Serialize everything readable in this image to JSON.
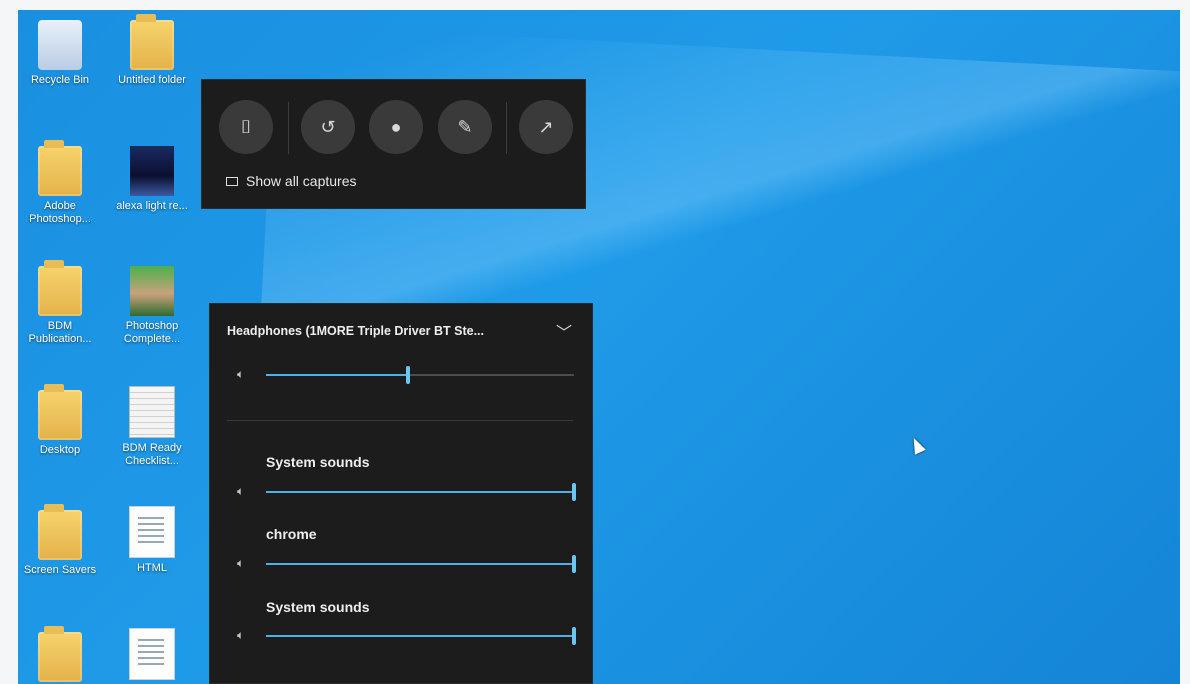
{
  "desktop_icons": [
    {
      "label": "Recycle Bin",
      "icon": "recycle-bin-icon"
    },
    {
      "label": "Untitled folder",
      "icon": "folder-icon"
    },
    {
      "label": "Adobe Photoshop...",
      "icon": "folder-icon"
    },
    {
      "label": "alexa light re...",
      "icon": "image-icon"
    },
    {
      "label": "BDM Publication...",
      "icon": "folder-icon"
    },
    {
      "label": "Photoshop Complete...",
      "icon": "photo-icon"
    },
    {
      "label": "Desktop",
      "icon": "folder-icon"
    },
    {
      "label": "BDM Ready Checklist...",
      "icon": "spreadsheet-icon"
    },
    {
      "label": "Screen Savers",
      "icon": "folder-icon"
    },
    {
      "label": "HTML",
      "icon": "document-icon"
    },
    {
      "label": "",
      "icon": "folder-icon"
    },
    {
      "label": "",
      "icon": "document-icon"
    }
  ],
  "capture_widget": {
    "buttons": [
      {
        "name": "screenshot",
        "icon": "camera-icon"
      },
      {
        "name": "record-last",
        "icon": "replay-icon"
      },
      {
        "name": "record",
        "icon": "record-icon"
      },
      {
        "name": "mic",
        "icon": "mic-off-icon"
      },
      {
        "name": "broadcast",
        "icon": "broadcast-icon"
      }
    ],
    "show_all_label": "Show all captures"
  },
  "audio_widget": {
    "device_name": "Headphones (1MORE Triple Driver BT Ste...",
    "master_volume": 0.46,
    "apps": [
      {
        "label": "System sounds",
        "volume": 1.0
      },
      {
        "label": "chrome",
        "volume": 1.0
      },
      {
        "label": "System sounds",
        "volume": 1.0
      }
    ]
  },
  "colors": {
    "accent": "#4fb1e6",
    "panel_bg": "#1c1c1c",
    "desktop_bg": "#1a8fe0"
  }
}
